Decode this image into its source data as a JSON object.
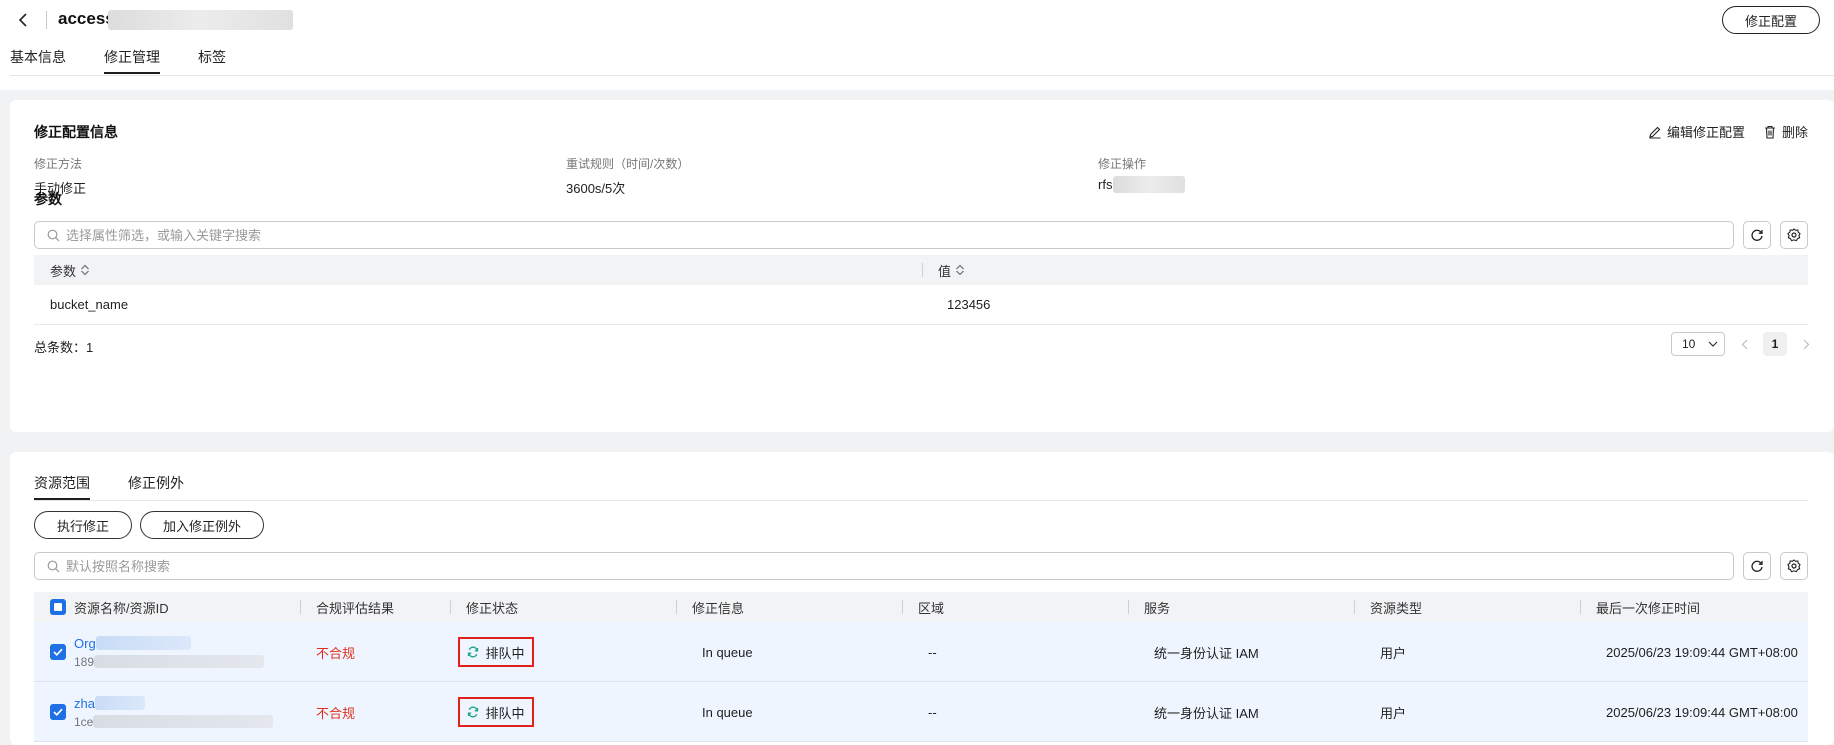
{
  "header": {
    "title": "access",
    "action_button": "修正配置",
    "tabs": [
      {
        "label": "基本信息",
        "active": false
      },
      {
        "label": "修正管理",
        "active": true
      },
      {
        "label": "标签",
        "active": false
      }
    ]
  },
  "config": {
    "title": "修正配置信息",
    "edit_label": "编辑修正配置",
    "delete_label": "删除",
    "fields": [
      {
        "label": "修正方法",
        "value": "手动修正"
      },
      {
        "label": "重试规则（时间/次数）",
        "value": "3600s/5次"
      },
      {
        "label": "修正操作",
        "value": "rfs-"
      }
    ],
    "params_title": "参数",
    "search_placeholder": "选择属性筛选，或输入关键字搜索",
    "columns": [
      "参数",
      "值"
    ],
    "rows": [
      {
        "param": "bucket_name",
        "value": "123456"
      }
    ],
    "total": "总条数：1",
    "page_size": "10",
    "current_page": "1"
  },
  "resources": {
    "tabs": [
      {
        "label": "资源范围",
        "active": true
      },
      {
        "label": "修正例外",
        "active": false
      }
    ],
    "execute_button": "执行修正",
    "add_exception_button": "加入修正例外",
    "search_placeholder": "默认按照名称搜索",
    "columns": [
      "资源名称/资源ID",
      "合规评估结果",
      "修正状态",
      "修正信息",
      "区域",
      "服务",
      "资源类型",
      "最后一次修正时间"
    ],
    "rows": [
      {
        "name": "Org",
        "id": "189",
        "compliance": "不合规",
        "status": "排队中",
        "info": "In queue",
        "region": "--",
        "service": "统一身份认证 IAM",
        "type": "用户",
        "time": "2025/06/23 19:09:44 GMT+08:00"
      },
      {
        "name": "zha",
        "id": "1ce",
        "compliance": "不合规",
        "status": "排队中",
        "info": "In queue",
        "region": "--",
        "service": "统一身份认证 IAM",
        "type": "用户",
        "time": "2025/06/23 19:09:44 GMT+08:00"
      }
    ]
  },
  "colors": {
    "accent": "#1f6fe5",
    "danger": "#e0301e",
    "status_icon": "#1aa38a",
    "highlight_border": "#e0201b"
  }
}
